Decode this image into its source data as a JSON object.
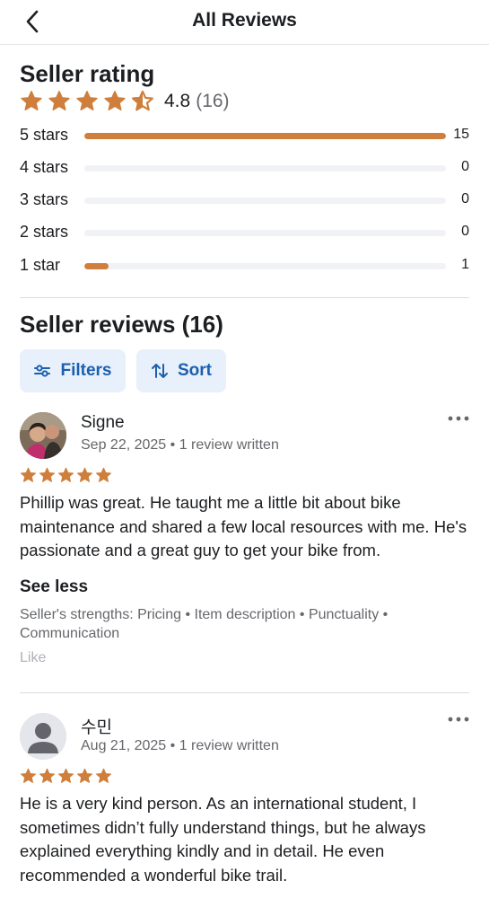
{
  "header": {
    "title": "All Reviews",
    "back_icon": "chevron-left-icon"
  },
  "seller_rating": {
    "title": "Seller rating",
    "average": "4.8",
    "count": "(16)",
    "stars": 4.5,
    "distribution": [
      {
        "label": "5 stars",
        "count": "15",
        "fraction": 1.0
      },
      {
        "label": "4 stars",
        "count": "0",
        "fraction": 0
      },
      {
        "label": "3 stars",
        "count": "0",
        "fraction": 0
      },
      {
        "label": "2 stars",
        "count": "0",
        "fraction": 0
      },
      {
        "label": "1 star",
        "count": "1",
        "fraction": 0.067
      }
    ]
  },
  "seller_reviews": {
    "title": "Seller reviews (16)",
    "filters_label": "Filters",
    "sort_label": "Sort",
    "items": [
      {
        "name": "Signe",
        "date": "Sep 22, 2025",
        "written": "1 review written",
        "stars": 5,
        "text": "Phillip was great. He taught me a little bit about bike maintenance and shared a few local resources with me. He's passionate and a great guy to get your bike from.",
        "see_less": "See less",
        "strengths": "Seller's strengths: Pricing • Item description • Punctuality • Communication",
        "like": "Like"
      },
      {
        "name": "수민",
        "date": "Aug 21, 2025",
        "written": "1 review written",
        "stars": 5,
        "text": "He is a very kind person. As an international student, I sometimes didn’t fully understand things, but he always explained everything kindly and in detail. He even recommended a wonderful bike trail."
      }
    ]
  },
  "colors": {
    "star": "#cf7f3b",
    "bar": "#cf7f3b",
    "chip_bg": "#e7f0fb",
    "chip_text": "#1b5fae"
  }
}
